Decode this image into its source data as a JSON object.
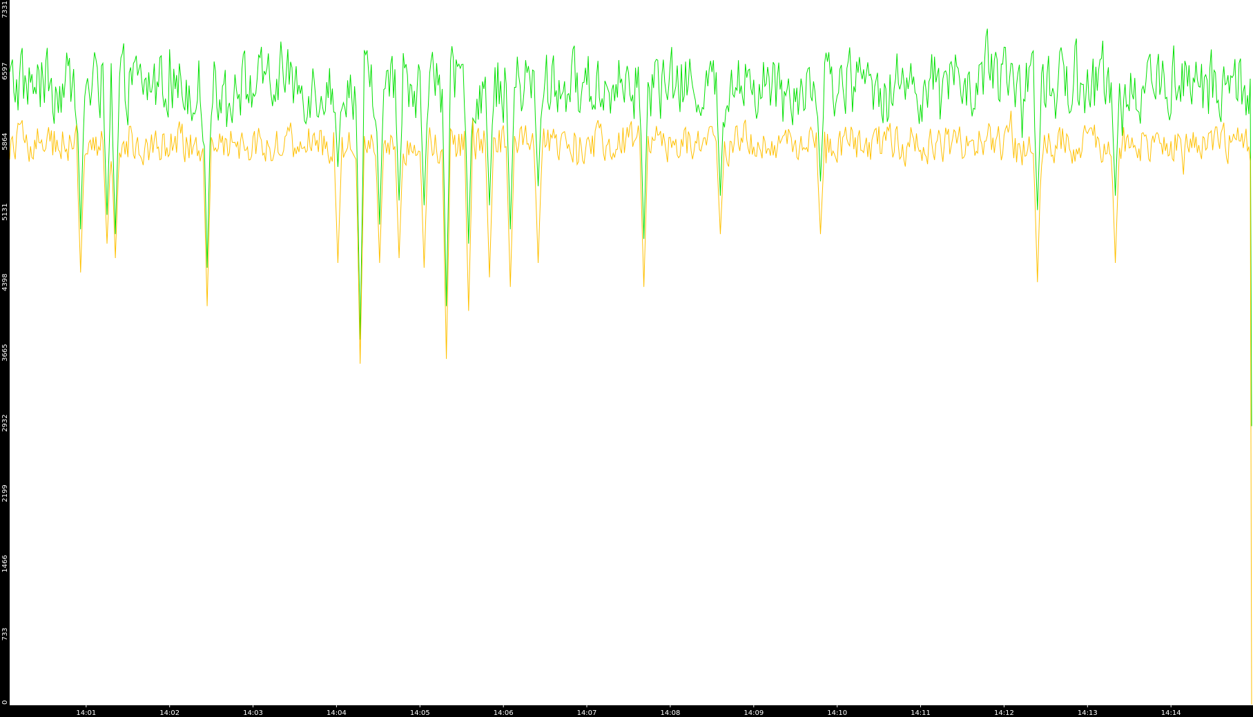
{
  "chart_data": {
    "type": "line",
    "title": "",
    "xlabel": "",
    "ylabel": "",
    "grid": false,
    "legend": "none",
    "colors": {
      "background": "#ffffff",
      "axis_bar": "#000000",
      "tick_text": "#ffffff"
    },
    "ylim": [
      0,
      7331
    ],
    "y_ticks": [
      "0",
      "733",
      "1466",
      "2199",
      "2932",
      "3665",
      "4398",
      "5131",
      "5864",
      "6597",
      "7331"
    ],
    "x_time_range": [
      "14:00:05",
      "14:14:58"
    ],
    "x_ticks": [
      "14:01",
      "14:02",
      "14:03",
      "14:04",
      "14:05",
      "14:06",
      "14:07",
      "14:08",
      "14:09",
      "14:10",
      "14:11",
      "14:12",
      "14:13",
      "14:14"
    ],
    "series": [
      {
        "color": "#00e000",
        "typical_range": [
          6000,
          6900
        ],
        "min": 3800,
        "max": 7310,
        "last_value": 2900,
        "dips": [
          {
            "time": "14:00:56",
            "value": 4950
          },
          {
            "time": "14:01:15",
            "value": 5100
          },
          {
            "time": "14:01:21",
            "value": 4900
          },
          {
            "time": "14:02:27",
            "value": 4550
          },
          {
            "time": "14:04:01",
            "value": 5600
          },
          {
            "time": "14:04:17",
            "value": 3800
          },
          {
            "time": "14:04:31",
            "value": 5000
          },
          {
            "time": "14:04:45",
            "value": 5250
          },
          {
            "time": "14:05:03",
            "value": 5200
          },
          {
            "time": "14:05:19",
            "value": 4150
          },
          {
            "time": "14:05:35",
            "value": 4800
          },
          {
            "time": "14:05:50",
            "value": 5200
          },
          {
            "time": "14:06:05",
            "value": 4950
          },
          {
            "time": "14:06:25",
            "value": 5400
          },
          {
            "time": "14:07:41",
            "value": 4850
          },
          {
            "time": "14:08:36",
            "value": 5300
          },
          {
            "time": "14:09:48",
            "value": 5450
          },
          {
            "time": "14:12:24",
            "value": 5150
          },
          {
            "time": "14:13:20",
            "value": 5300
          }
        ]
      },
      {
        "color": "#ffc000",
        "typical_range": [
          5600,
          6100
        ],
        "min": 3550,
        "max": 6400,
        "last_value": 0,
        "dips": [
          {
            "time": "14:00:56",
            "value": 4500
          },
          {
            "time": "14:01:15",
            "value": 4800
          },
          {
            "time": "14:01:21",
            "value": 4650
          },
          {
            "time": "14:02:27",
            "value": 4150
          },
          {
            "time": "14:04:01",
            "value": 4600
          },
          {
            "time": "14:04:17",
            "value": 3550
          },
          {
            "time": "14:04:31",
            "value": 4600
          },
          {
            "time": "14:04:45",
            "value": 4650
          },
          {
            "time": "14:05:03",
            "value": 4550
          },
          {
            "time": "14:05:19",
            "value": 3600
          },
          {
            "time": "14:05:35",
            "value": 4100
          },
          {
            "time": "14:05:50",
            "value": 4450
          },
          {
            "time": "14:06:05",
            "value": 4350
          },
          {
            "time": "14:06:25",
            "value": 4600
          },
          {
            "time": "14:07:41",
            "value": 4350
          },
          {
            "time": "14:08:36",
            "value": 4900
          },
          {
            "time": "14:09:48",
            "value": 4900
          },
          {
            "time": "14:12:24",
            "value": 4400
          },
          {
            "time": "14:13:20",
            "value": 4600
          }
        ]
      }
    ]
  }
}
